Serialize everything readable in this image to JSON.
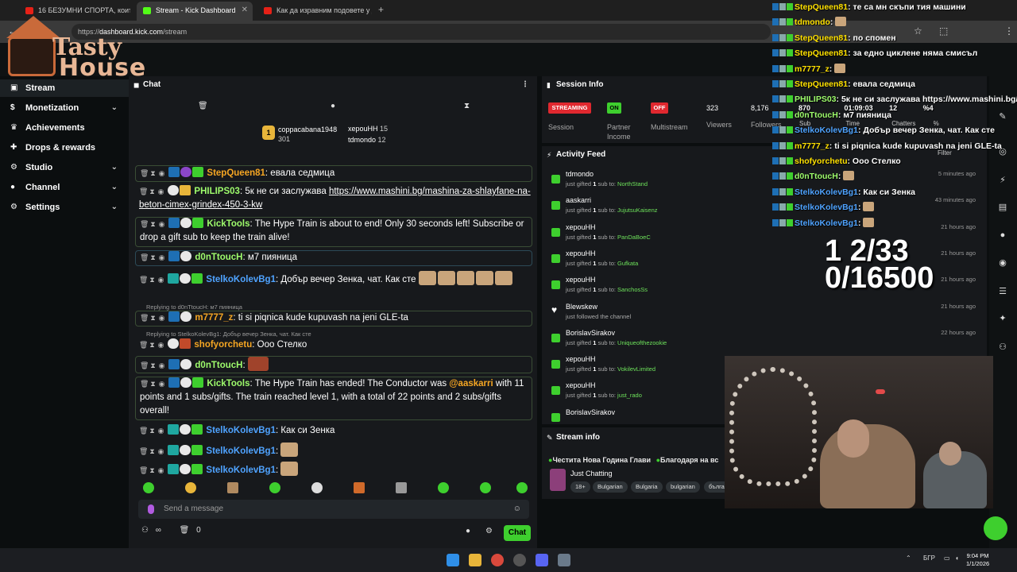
{
  "browser": {
    "tabs": [
      {
        "label": "16 БЕЗУМНИ СПОРТА, които І",
        "color": "#e62117"
      },
      {
        "label": "Stream - Kick Dashboard",
        "color": "#53fc18"
      },
      {
        "label": "Как да изравним подовете у д",
        "color": "#e62117"
      }
    ],
    "url_prefix": "https://",
    "url_host": "dashboard.kick.com",
    "url_path": "/stream"
  },
  "logo": {
    "line1": "Tasty",
    "line2": "House"
  },
  "sidebar": {
    "items": [
      {
        "label": "Stream",
        "icon": "stream-icon"
      },
      {
        "label": "Monetization",
        "icon": "coins-icon"
      },
      {
        "label": "Achievements",
        "icon": "trophy-icon"
      },
      {
        "label": "Drops & rewards",
        "icon": "gift-icon"
      },
      {
        "label": "Studio",
        "icon": "gear-icon"
      },
      {
        "label": "Channel",
        "icon": "user-icon"
      },
      {
        "label": "Settings",
        "icon": "settings-icon"
      }
    ]
  },
  "chat": {
    "title": "Chat",
    "leaders": [
      {
        "name": "coppacabana1948",
        "count": "301"
      },
      {
        "name": "xepouHH",
        "count": "15"
      },
      {
        "name": "tdmondo",
        "count": "12"
      }
    ],
    "leader_rank": "1",
    "messages": [
      {
        "user": "StepQueen81",
        "text": ": евала седмица"
      },
      {
        "user": "PHILIPS03",
        "text": ": 5к не си заслужава ",
        "link": "https://www.mashini.bg/mashina-za-shlayfane-na-beton-cimex-grindex-450-3-kw"
      },
      {
        "user": "KickTools",
        "text": ": The Hype Train is about to end! Only 30 seconds left! Subscribe or drop a gift sub to keep the train alive!"
      },
      {
        "user": "d0nTtoucH",
        "text": ": м7 пияница"
      },
      {
        "user": "StelkoKolevBg1",
        "text": ": Добър вечер Зенка, чат. Как сте"
      },
      {
        "user": "m7777_z",
        "text": ": ti si piqnica kude kupuvash na jeni GLE-ta"
      },
      {
        "user": "shofyorchetu",
        "text": ": Ооо Стелко"
      },
      {
        "user": "d0nTtoucH",
        "text": ":"
      },
      {
        "user": "KickTools",
        "text": ": The Hype Train has ended! The Conductor was ",
        "mention": "@aaskarri",
        "text2": " with 11 points and 1 subs/gifts. The train reached level 1, with a total of 22 points and 2 subs/gifts overall!"
      },
      {
        "user": "StelkoKolevBg1",
        "text": ": Как си Зенка"
      },
      {
        "user": "StelkoKolevBg1",
        "text": ":"
      },
      {
        "user": "StelkoKolevBg1",
        "text": ":"
      }
    ],
    "replies": [
      "Replying to d0nTtoucH: м7 пияница",
      "Replying to StelkoKolevBg1: Добър вечер Зенка, чат. Как сте"
    ],
    "placeholder": "Send a message",
    "footer_count": "0",
    "chat_button": "Chat"
  },
  "session": {
    "title": "Session Info",
    "streaming": "STREAMING",
    "on": "ON",
    "off": "OFF",
    "labels": {
      "session": "Session",
      "partner": "Partner Income",
      "multistream": "Multistream",
      "viewers": "Viewers",
      "followers": "Followers"
    },
    "viewers": "323",
    "followers": "8,176"
  },
  "activity": {
    "title": "Activity Feed",
    "items": [
      {
        "who": "tdmondo",
        "pre": "just gifted ",
        "n": "1",
        "post": " sub to: ",
        "to": "NorthStand",
        "ago": "5 minutes ago"
      },
      {
        "who": "aaskarri",
        "pre": "just gifted ",
        "n": "1",
        "post": " sub to: ",
        "to": "JujutsuKaisenz",
        "ago": "43 minutes ago"
      },
      {
        "who": "xepouHH",
        "pre": "just gifted ",
        "n": "1",
        "post": " sub to: ",
        "to": "PanDaBoeC",
        "ago": "21 hours ago"
      },
      {
        "who": "xepouHH",
        "pre": "just gifted ",
        "n": "1",
        "post": " sub to: ",
        "to": "Gufkata",
        "ago": "21 hours ago"
      },
      {
        "who": "xepouHH",
        "pre": "just gifted ",
        "n": "1",
        "post": " sub to: ",
        "to": "SanchosSs",
        "ago": "21 hours ago"
      },
      {
        "who": "Blewskew",
        "pre": "just followed the channel",
        "n": "",
        "post": "",
        "to": "",
        "ago": "21 hours ago"
      },
      {
        "who": "BorislavSirakov",
        "pre": "just gifted ",
        "n": "1",
        "post": " sub to: ",
        "to": "Uniqueofthezookie",
        "ago": "22 hours ago"
      },
      {
        "who": "xepouHH",
        "pre": "just gifted ",
        "n": "1",
        "post": " sub to: ",
        "to": "VokilevLimited",
        "ago": "21 hours ago"
      },
      {
        "who": "xepouHH",
        "pre": "just gifted ",
        "n": "1",
        "post": " sub to: ",
        "to": "just_rado",
        "ago": "21 hours ago"
      },
      {
        "who": "BorislavSirakov",
        "pre": "",
        "n": "",
        "post": "",
        "to": "",
        "ago": ""
      }
    ]
  },
  "stream_info": {
    "title": "Stream info",
    "stream_title": "Честита Нова Година Глави",
    "stream_title2": "Благодаря на вс",
    "category": "Just Chatting",
    "tags": [
      "18+",
      "Bulgarian",
      "Bulgaria",
      "bulgarian",
      "бълга"
    ]
  },
  "overlay": {
    "lines": [
      {
        "user": "StepQueen81",
        "text": ": те са мн скъпи тия машини",
        "color": "#ffe100"
      },
      {
        "user": "tdmondo",
        "text": ":",
        "color": "#ffe100"
      },
      {
        "user": "StepQueen81",
        "text": ": по спомен",
        "color": "#ffe100"
      },
      {
        "user": "StepQueen81",
        "text": ": за едно циклене няма смисъл",
        "color": "#ffe100"
      },
      {
        "user": "m7777_z",
        "text": ":",
        "color": "#ffe100"
      },
      {
        "user": "StepQueen81",
        "text": ": евала седмица",
        "color": "#ffe100"
      },
      {
        "user": "PHILIPS03",
        "text": ": 5к не си заслужава https://www.mashini.bg/m",
        "color": "#9efc6c"
      },
      {
        "user": "d0nTtoucH",
        "text": ": м7 пияница",
        "color": "#9efc6c"
      },
      {
        "user": "StelkoKolevBg1",
        "text": ": Добър вечер Зенка, чат. Как сте",
        "color": "#4fa3ff"
      },
      {
        "user": "m7777_z",
        "text": ": ti si piqnica kude kupuvash na jeni GLE-ta",
        "color": "#ffe100"
      },
      {
        "user": "shofyorchetu",
        "text": ": Ооо Стелко",
        "color": "#ffe100"
      },
      {
        "user": "d0nTtoucH",
        "text": ":",
        "color": "#9efc6c"
      },
      {
        "user": "StelkoKolevBg1",
        "text": ": Как си Зенка",
        "color": "#4fa3ff"
      },
      {
        "user": "StelkoKolevBg1",
        "text": ":",
        "color": "#4fa3ff"
      },
      {
        "user": "StelkoKolevBg1",
        "text": ":",
        "color": "#4fa3ff"
      }
    ],
    "stats_numbers": [
      "870",
      "01:09:03",
      "12",
      "%4"
    ],
    "stats_labels": [
      "Sub",
      "Time",
      "Chatters",
      "%"
    ],
    "goal_line1": "1 2/33",
    "goal_line2": "0/16500",
    "filter": "Filter"
  },
  "taskbar": {
    "lang": "БГР",
    "time": "9:04 PM",
    "date": "1/1/2026"
  },
  "colors": {
    "kick_green": "#53fc18",
    "username_yellow": "#ffe100",
    "username_blue": "#4fa3ff",
    "username_green": "#9efc6c",
    "username_orange": "#f5a623"
  }
}
